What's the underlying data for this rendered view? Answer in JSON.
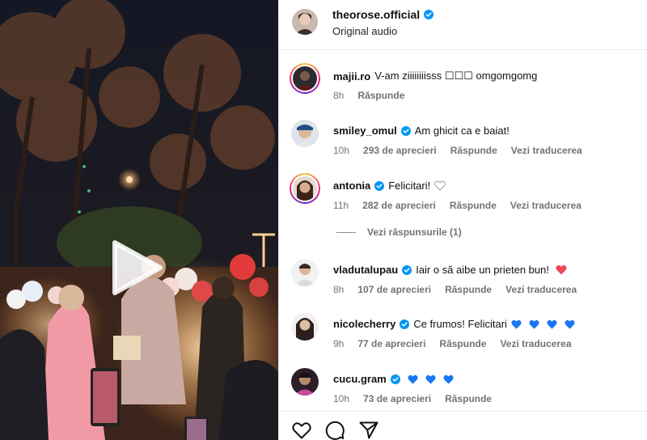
{
  "post": {
    "username": "theorose.official",
    "subtitle": "Original audio"
  },
  "comments": [
    {
      "username": "majii.ro",
      "verified": false,
      "text": "V-am ziiiiiiiisss ☐☐☐ omgomgomg",
      "time": "8h",
      "likes": "",
      "reply": "Răspunde",
      "translate": "",
      "story_ring": true
    },
    {
      "username": "smiley_omul",
      "verified": true,
      "text": "Am ghicit ca e baiat!",
      "time": "10h",
      "likes": "293 de aprecieri",
      "reply": "Răspunde",
      "translate": "Vezi traducerea",
      "story_ring": false
    },
    {
      "username": "antonia",
      "verified": true,
      "text": "Felicitari!",
      "time": "11h",
      "likes": "282 de aprecieri",
      "reply": "Răspunde",
      "translate": "Vezi traducerea",
      "story_ring": true,
      "trailing_icon": "white-heart-icon"
    },
    {
      "username": "vladutalupau",
      "verified": true,
      "text": "Iair o să aibe un prieten bun!",
      "time": "8h",
      "likes": "107 de aprecieri",
      "reply": "Răspunde",
      "translate": "Vezi traducerea",
      "story_ring": false,
      "trailing_icon": "red-heart-icon"
    },
    {
      "username": "nicolecherry",
      "verified": true,
      "text": "Ce frumos! Felicitari",
      "time": "9h",
      "likes": "77 de aprecieri",
      "reply": "Răspunde",
      "translate": "Vezi traducerea",
      "story_ring": false,
      "trailing_icon": "blue-heart-icon",
      "trailing_count": 4
    },
    {
      "username": "cucu.gram",
      "verified": true,
      "text": "",
      "time": "10h",
      "likes": "73 de aprecieri",
      "reply": "Răspunde",
      "translate": "",
      "story_ring": false,
      "trailing_icon": "blue-heart-icon",
      "trailing_count": 3
    }
  ],
  "view_replies": "Vezi răspunsurile (1)",
  "actions": [
    "like-icon",
    "comment-icon",
    "share-icon"
  ],
  "colors": {
    "verified_blue": "#0095f6",
    "red_heart": "#ed4956",
    "blue_heart": "#1877f2",
    "meta_gray": "#737373"
  }
}
